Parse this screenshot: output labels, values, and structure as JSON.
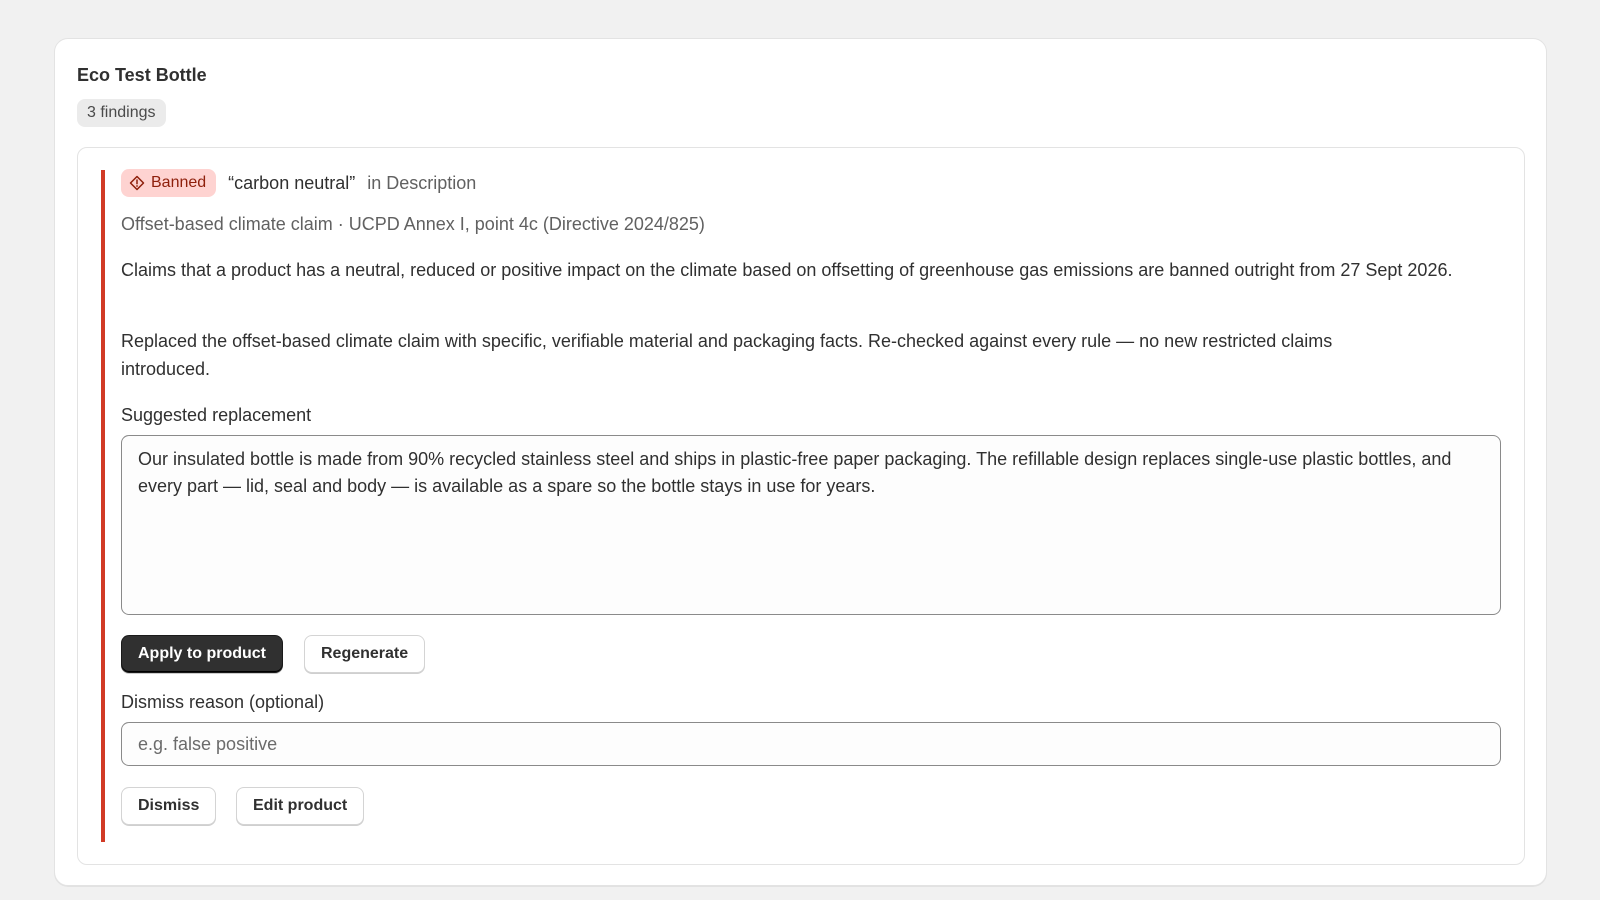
{
  "product": {
    "title": "Eco Test Bottle",
    "findings_count": "3 findings"
  },
  "finding": {
    "severity_label": "Banned",
    "severity_icon": "diamond-alert-icon",
    "severity_color": "#d13a25",
    "phrase": "“carbon neutral”",
    "location": "in Description",
    "rule": "Offset-based climate claim · UCPD Annex I, point 4c (Directive 2024/825)",
    "explanation": "Claims that a product has a neutral, reduced or positive impact on the climate based on offsetting of greenhouse gas emissions are banned outright from 27 Sept 2026.",
    "change_note": "Replaced the offset-based climate claim with specific, verifiable material and packaging facts. Re-checked against every rule — no new restricted claims introduced.",
    "suggested_label": "Suggested replacement",
    "suggested_text": "Our insulated bottle is made from 90% recycled stainless steel and ships in plastic-free paper packaging. The refillable design replaces single-use plastic bottles, and every part — lid, seal and body — is available as a spare so the bottle stays in use for years.",
    "apply_label": "Apply to product",
    "regenerate_label": "Regenerate",
    "dismiss_reason_label": "Dismiss reason (optional)",
    "dismiss_reason_value": "",
    "dismiss_reason_placeholder": "e.g. false positive",
    "dismiss_label": "Dismiss",
    "edit_label": "Edit product"
  }
}
